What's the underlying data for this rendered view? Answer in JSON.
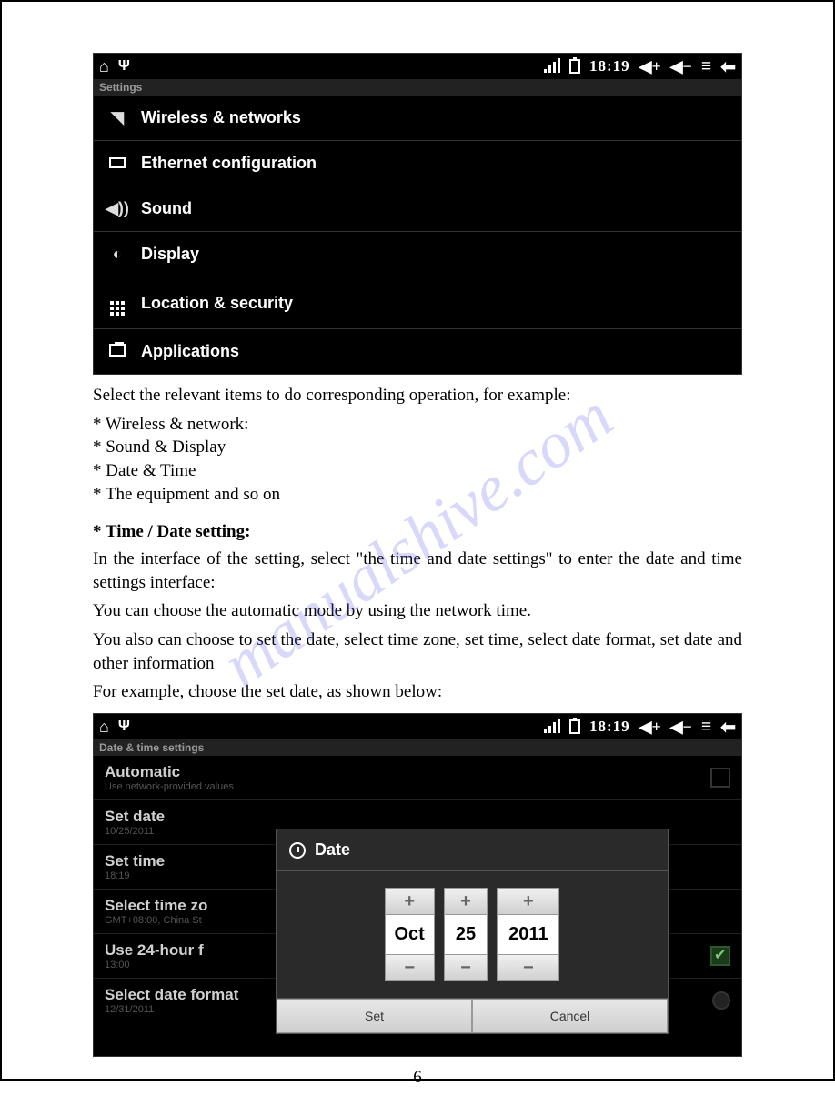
{
  "statusbar": {
    "time": "18:19"
  },
  "screenshot1": {
    "header": "Settings",
    "items": [
      {
        "label": "Wireless & networks"
      },
      {
        "label": "Ethernet configuration"
      },
      {
        "label": "Sound"
      },
      {
        "label": "Display"
      },
      {
        "label": "Location & security"
      },
      {
        "label": "Applications"
      }
    ]
  },
  "text": {
    "intro": "Select the relevant items to do corresponding operation, for example:",
    "b1": "* Wireless & network:",
    "b2": "* Sound & Display",
    "b3": "* Date & Time",
    "b4": "* The equipment and so on",
    "h": "* Time / Date setting:",
    "p1": "In the interface of the setting, select \"the time and date settings\" to enter the date and time settings interface:",
    "p2": "You can choose the automatic mode by using the network time.",
    "p3": "You also can choose to set the date, select time zone, set time, select date format, set date and other information",
    "p4": "For example, choose the set date, as shown below:"
  },
  "screenshot2": {
    "header": "Date & time settings",
    "rows": {
      "automatic": {
        "t": "Automatic",
        "s": "Use network-provided values"
      },
      "setdate": {
        "t": "Set date",
        "s": "10/25/2011"
      },
      "settime": {
        "t": "Set time",
        "s": "18:19"
      },
      "tz": {
        "t": "Select time zo",
        "s": "GMT+08:00, China St"
      },
      "h24": {
        "t": "Use 24-hour f",
        "s": "13:00"
      },
      "fmt": {
        "t": "Select date format",
        "s": "12/31/2011"
      }
    },
    "dialog": {
      "title": "Date",
      "month": "Oct",
      "day": "25",
      "year": "2011",
      "set": "Set",
      "cancel": "Cancel"
    }
  },
  "watermark": "manualshive.com",
  "pagenum": "6"
}
